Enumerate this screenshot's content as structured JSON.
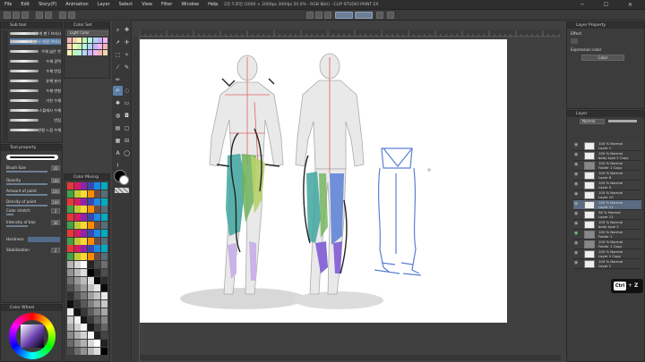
{
  "menu": [
    "File",
    "Edit",
    "Story(P)",
    "Animation",
    "Layer",
    "Select",
    "View",
    "Filter",
    "Window",
    "Help"
  ],
  "window_title": "2강 드로잉 (2000 × 2000px 300dpi 50.0%  - RGB 8bit) - CLIP STUDIO PAINT EX",
  "window_buttons": "─ ☐ ✕",
  "sub_tool_panel": {
    "header": "Sub tool",
    "brushes": [
      "지우개 펜 / 브러시",
      "수채 붓 + 데칼 브러시",
      "수채 넓은 붓",
      "수채 광역",
      "수채 번짐",
      "유채 분리",
      "수채 변형",
      "거친 수채",
      "스플래시 수채",
      "번짐",
      "연필 느낌 수채"
    ]
  },
  "tool_property": {
    "header": "Tool property",
    "rows": [
      {
        "label": "Brush Size",
        "value": "20"
      },
      {
        "label": "Opacity",
        "value": "100"
      },
      {
        "label": "Amount of paint",
        "value": "100"
      },
      {
        "label": "Density of paint",
        "value": "100"
      },
      {
        "label": "Color stretch",
        "value": "2"
      },
      {
        "label": "Intensity of blur",
        "value": "30"
      },
      {
        "label": "Hardness",
        "value": ""
      },
      {
        "label": "Stabilization",
        "value": "2"
      }
    ]
  },
  "color_set_header": "Color Set",
  "color_set_select": "Light Color",
  "color_wheel_header": "Color Wheel",
  "color_history_header": "Color Mixing",
  "layer_property": {
    "header": "Layer Property",
    "effect_label": "Effect",
    "expression_label": "Expression color",
    "expression_value": "Color"
  },
  "layer_panel": {
    "header": "Layer",
    "blend_mode": "Normal",
    "layers": [
      {
        "top": "100 % Normal",
        "name": "Layer 1"
      },
      {
        "top": "100 % Normal",
        "name": "body type 2 Copy"
      },
      {
        "top": "100 % Normal",
        "name": "Folder 1 Copy"
      },
      {
        "top": "100 % Normal",
        "name": "Layer 8"
      },
      {
        "top": "100 % Normal",
        "name": "Layer 9"
      },
      {
        "top": "100 % Normal",
        "name": "Layer 10"
      },
      {
        "top": "100 % Normal",
        "name": "Layer 11"
      },
      {
        "top": "36 % Normal",
        "name": "Layer 11"
      },
      {
        "top": "100 % Normal",
        "name": "body type 2"
      },
      {
        "top": "100 % Normal",
        "name": "Folder 1"
      },
      {
        "top": "100 % Normal",
        "name": "Folder 1 Copy"
      },
      {
        "top": "100 % Normal",
        "name": "Layer 1 Copy"
      },
      {
        "top": "100 % Normal",
        "name": "Layer 1"
      }
    ]
  },
  "shortcut": {
    "key1": "Ctrl",
    "plus": "+",
    "key2": "Z"
  },
  "colors": {
    "accent": "#5c7fa8",
    "bg": "#404040",
    "canvas": "#ffffff",
    "sketch_blue": "#5b7fd6",
    "green": "#6fb35a",
    "purple": "#8a6ad6",
    "teal": "#3fa6a0"
  }
}
